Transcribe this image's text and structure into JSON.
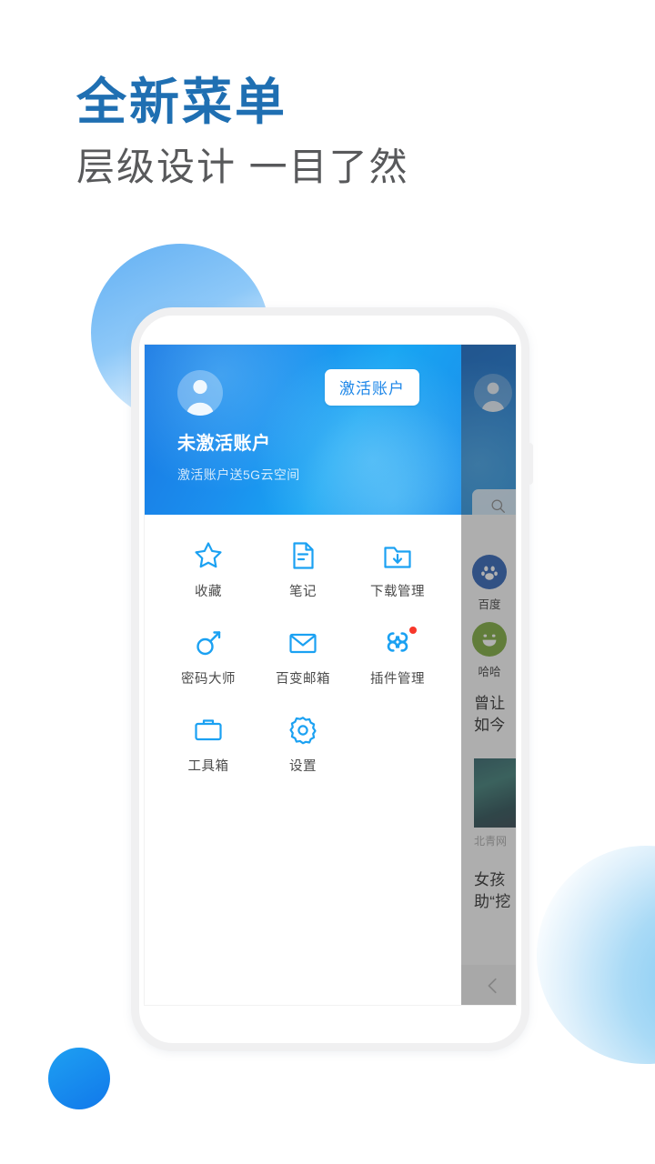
{
  "promo": {
    "headline": "全新菜单",
    "subheadline": "层级设计 一目了然"
  },
  "colors": {
    "headline": "#1f6fb2",
    "subheadline": "#58595b",
    "header_gradient_start": "#1876e2",
    "header_gradient_end": "#18a6f3",
    "icon_blue": "#1ba1f2",
    "badge_red": "#f8372a"
  },
  "phone": {
    "menu_drawer": {
      "account": {
        "name": "未激活账户",
        "subtitle": "激活账户送5G云空间",
        "activate_label": "激活账户",
        "avatar_icon": "person-avatar-icon"
      },
      "grid_items": [
        {
          "label": "收藏",
          "icon": "star-icon",
          "badge": false
        },
        {
          "label": "笔记",
          "icon": "note-document-icon",
          "badge": false
        },
        {
          "label": "下载管理",
          "icon": "folder-download-icon",
          "badge": false
        },
        {
          "label": "密码大师",
          "icon": "key-icon",
          "badge": false
        },
        {
          "label": "百变邮箱",
          "icon": "envelope-icon",
          "badge": false
        },
        {
          "label": "插件管理",
          "icon": "plugin-clover-icon",
          "badge": true
        },
        {
          "label": "工具箱",
          "icon": "toolbox-icon",
          "badge": false
        },
        {
          "label": "设置",
          "icon": "gear-icon",
          "badge": false
        }
      ]
    },
    "background_page": {
      "avatar_icon": "person-avatar-icon",
      "search_icon": "search-icon",
      "shortcuts": [
        {
          "label": "百度",
          "icon": "baidu-paw-icon",
          "color": "#2a5fb4"
        },
        {
          "label": "哈哈",
          "icon": "smiley-face-icon",
          "color": "#7ba93a"
        }
      ],
      "news": [
        {
          "title": "曾让\n如今",
          "source": "北青网"
        },
        {
          "title": "女孩\n助“挖",
          "source": ""
        }
      ],
      "back_icon": "chevron-left-icon"
    }
  }
}
